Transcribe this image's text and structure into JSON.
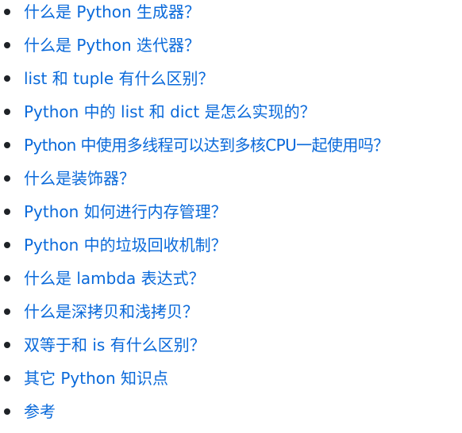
{
  "toc": {
    "items": [
      {
        "label": "什么是 Python 生成器？"
      },
      {
        "label": "什么是 Python 迭代器？"
      },
      {
        "label": "list 和 tuple 有什么区别？"
      },
      {
        "label": "Python 中的 list 和 dict 是怎么实现的？"
      },
      {
        "label": "Python 中使用多线程可以达到多核CPU一起使用吗？"
      },
      {
        "label": "什么是装饰器？"
      },
      {
        "label": "Python 如何进行内存管理？"
      },
      {
        "label": "Python 中的垃圾回收机制？"
      },
      {
        "label": "什么是 lambda 表达式？"
      },
      {
        "label": "什么是深拷贝和浅拷贝？"
      },
      {
        "label": "双等于和 is 有什么区别？"
      },
      {
        "label": "其它 Python 知识点"
      },
      {
        "label": "参考"
      }
    ]
  },
  "colors": {
    "link": "#0969da",
    "bullet": "#1f2328",
    "background": "#ffffff"
  }
}
